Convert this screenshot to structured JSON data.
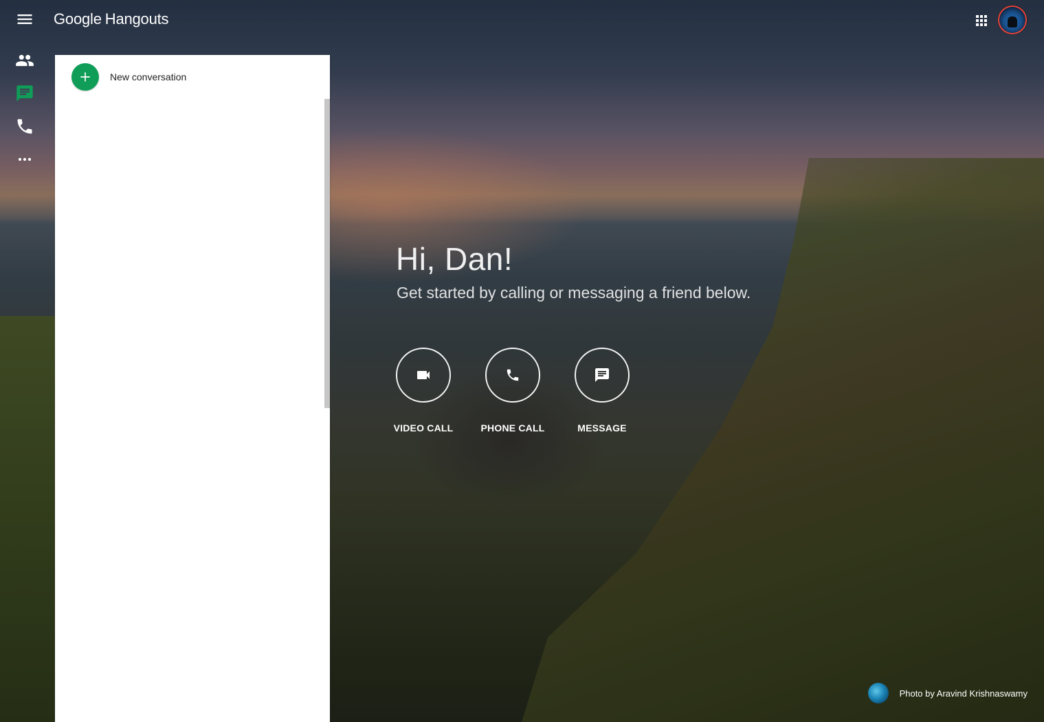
{
  "app": {
    "brand_google": "Google",
    "brand_product": "Hangouts"
  },
  "topbar": {
    "menu_icon": "hamburger-menu-icon",
    "apps_icon": "apps-grid-icon",
    "avatar_icon": "account-avatar"
  },
  "rail": {
    "items": [
      {
        "name": "contacts",
        "icon": "people-icon",
        "active": false
      },
      {
        "name": "conversations",
        "icon": "chat-icon",
        "active": true
      },
      {
        "name": "phone-calls",
        "icon": "phone-icon",
        "active": false
      },
      {
        "name": "more",
        "icon": "more-horiz-icon",
        "active": false
      }
    ]
  },
  "panel": {
    "new_conversation_label": "New conversation"
  },
  "hero": {
    "greeting": "Hi, Dan!",
    "subtitle": "Get started by calling or messaging a friend below.",
    "actions": [
      {
        "label": "VIDEO CALL",
        "icon": "videocam-icon"
      },
      {
        "label": "PHONE CALL",
        "icon": "phone-icon"
      },
      {
        "label": "MESSAGE",
        "icon": "message-icon"
      }
    ]
  },
  "credit": {
    "text": "Photo by Aravind Krishnaswamy"
  },
  "colors": {
    "accent_green": "#0f9d58",
    "active_rail_icon": "#0f9d58",
    "white": "#ffffff"
  }
}
